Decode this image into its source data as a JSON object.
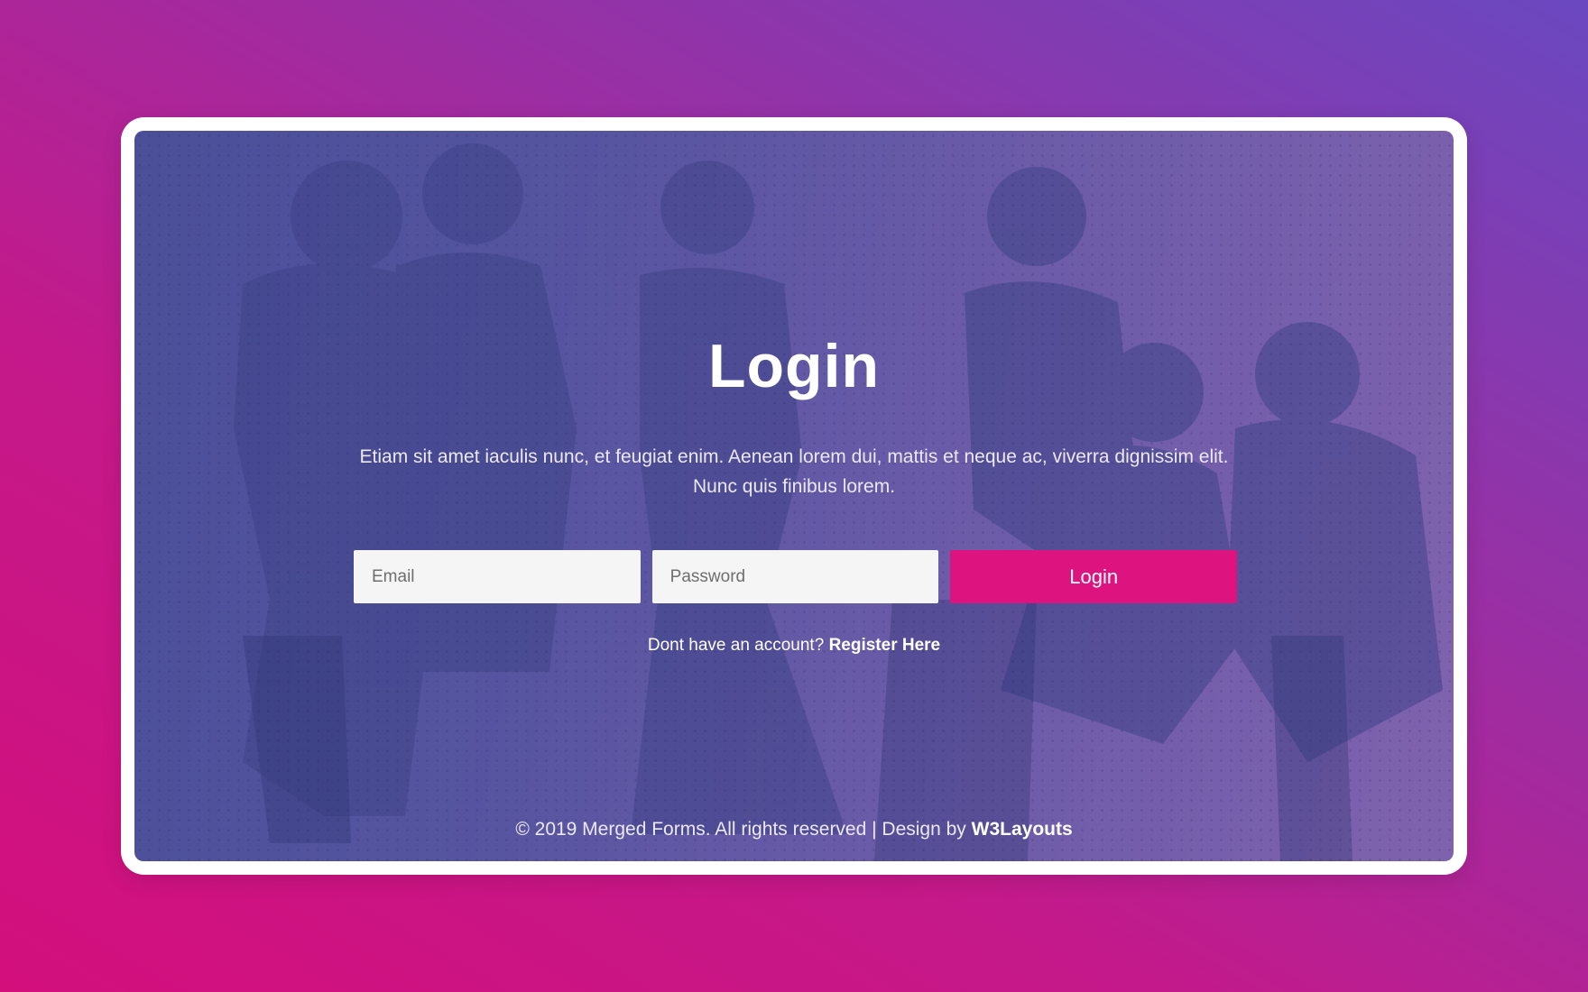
{
  "login": {
    "title": "Login",
    "description": "Etiam sit amet iaculis nunc, et feugiat enim. Aenean lorem dui, mattis et neque ac, viverra dignissim elit. Nunc quis finibus lorem.",
    "email_placeholder": "Email",
    "email_value": "",
    "password_placeholder": "Password",
    "password_value": "",
    "submit_label": "Login",
    "register_prompt": "Dont have an account?",
    "register_link": "Register Here"
  },
  "footer": {
    "copyright": "© 2019 Merged Forms. All rights reserved | Design by",
    "credit_link": "W3Layouts"
  },
  "colors": {
    "background_start": "#d30f7c",
    "background_end": "#6a48c0",
    "button": "#dd1480",
    "overlay": "#55549f"
  },
  "background_image": {
    "description": "group-of-people-photo",
    "icon": "photo-icon"
  }
}
